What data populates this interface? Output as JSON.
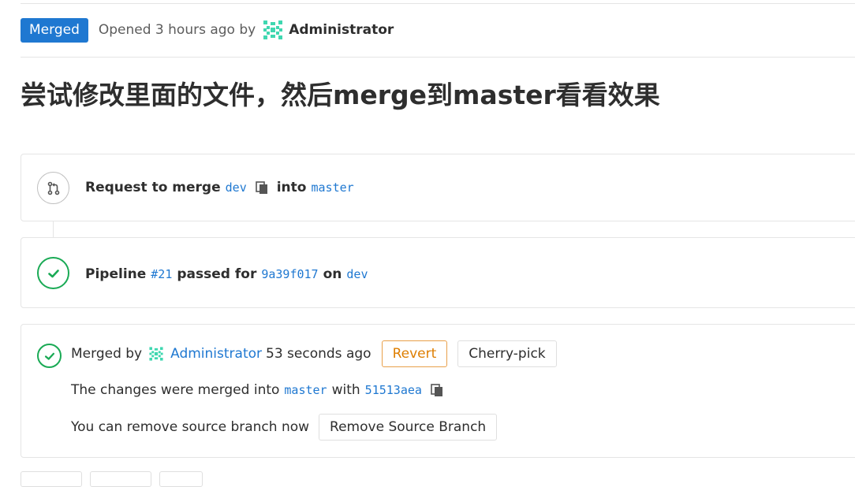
{
  "header": {
    "status_badge": "Merged",
    "opened_text": "Opened 3 hours ago by",
    "author": "Administrator"
  },
  "title": "尝试修改里面的文件，然后merge到master看看效果",
  "merge_request": {
    "prefix": "Request to merge",
    "source_branch": "dev",
    "into_label": "into",
    "target_branch": "master"
  },
  "pipeline": {
    "label": "Pipeline",
    "number": "#21",
    "passed_for": "passed for",
    "commit": "9a39f017",
    "on_label": "on",
    "branch": "dev"
  },
  "merged": {
    "merged_by": "Merged by",
    "author": "Administrator",
    "time": "53 seconds ago",
    "revert_label": "Revert",
    "cherry_pick_label": "Cherry-pick",
    "changes_prefix": "The changes were merged into",
    "target_branch": "master",
    "with_label": "with",
    "merge_commit": "51513aea",
    "remove_text": "You can remove source branch now",
    "remove_button": "Remove Source Branch"
  },
  "colors": {
    "accent": "#1f78d1",
    "success": "#1aaa55",
    "warning": "#de7e00"
  },
  "icons": [
    "merge-request-icon",
    "copy-icon",
    "check-circle-icon",
    "identicon-avatar"
  ]
}
